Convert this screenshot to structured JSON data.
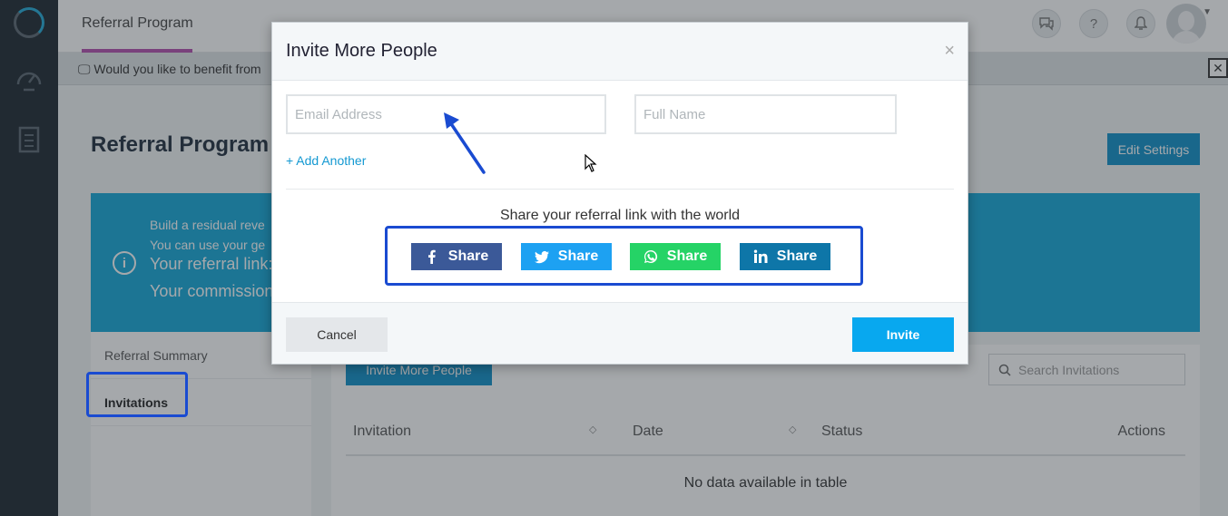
{
  "topbar": {
    "title": "Referral Program"
  },
  "notice": {
    "text": "Would you like to benefit from",
    "close": "✕"
  },
  "page": {
    "heading": "Referral Program",
    "edit_settings": "Edit Settings"
  },
  "banner": {
    "line1": "Build a residual reve",
    "line2": "You can use your ge",
    "line3": "Your referral link:",
    "line4": "Your commission"
  },
  "sidenav": {
    "items": [
      {
        "label": "Referral Summary"
      },
      {
        "label": "Invitations"
      }
    ]
  },
  "panel": {
    "invite_button": "Invite More People",
    "search_placeholder": "Search Invitations",
    "columns": [
      "Invitation",
      "Date",
      "Status",
      "Actions"
    ],
    "empty": "No data available in table"
  },
  "modal": {
    "title": "Invite More People",
    "close": "×",
    "email_placeholder": "Email Address",
    "name_placeholder": "Full Name",
    "add_another": "+ Add Another",
    "share_label": "Share your referral link with the world",
    "share_buttons": [
      {
        "label": "Share",
        "icon": "facebook-icon",
        "color": "#3b5998"
      },
      {
        "label": "Share",
        "icon": "twitter-icon",
        "color": "#1da1f2"
      },
      {
        "label": "Share",
        "icon": "whatsapp-icon",
        "color": "#25d366"
      },
      {
        "label": "Share",
        "icon": "linkedin-icon",
        "color": "#0e76a8"
      }
    ],
    "cancel": "Cancel",
    "invite": "Invite"
  },
  "colors": {
    "accent": "#0f8fc9",
    "banner": "#13a7d8",
    "annotation": "#1a4bd1"
  }
}
